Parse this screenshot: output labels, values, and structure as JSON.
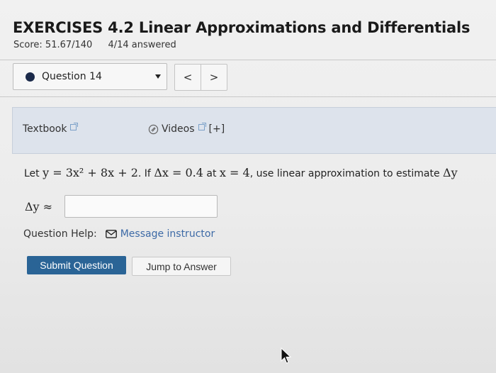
{
  "header": {
    "title": "EXERCISES 4.2 Linear Approximations and Differentials",
    "score": "Score: 51.67/140",
    "answered": "4/14 answered"
  },
  "question_nav": {
    "selected": "Question 14",
    "prev": "<",
    "next": ">"
  },
  "help_panel": {
    "textbook": "Textbook",
    "videos": "Videos",
    "videos_more": "[+]"
  },
  "problem": {
    "let": "Let",
    "equation": "y = 3x² + 8x + 2",
    "if": ". If",
    "delta": "Δx = 0.4",
    "at": "at",
    "point": "x = 4",
    "instruction": ", use linear approximation to estimate",
    "target": "Δy"
  },
  "answer": {
    "label": "Δy ≈",
    "value": ""
  },
  "question_help": {
    "label": "Question Help:",
    "message": "Message instructor"
  },
  "actions": {
    "submit": "Submit Question",
    "jump": "Jump to Answer"
  },
  "icons": {
    "question_status": "filled-circle-icon",
    "dropdown": "caret-down-icon",
    "external_link": "external-link-icon",
    "video_clip": "paperclip-icon",
    "mail": "mail-icon",
    "cursor": "mouse-pointer-icon"
  },
  "colors": {
    "submit_bg": "#2a6496",
    "link": "#3d6aa6",
    "panel_bg": "#dde3ec"
  }
}
